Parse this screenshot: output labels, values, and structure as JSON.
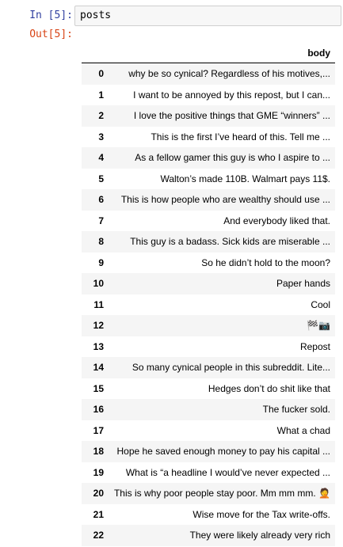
{
  "input_cell": {
    "prompt": "In [5]:",
    "code": "posts"
  },
  "output_cell": {
    "prompt": "Out[5]:"
  },
  "dataframe": {
    "columns": [
      "",
      "body"
    ],
    "rows": [
      {
        "index": "0",
        "body": "why be so cynical? Regardless of his motives,..."
      },
      {
        "index": "1",
        "body": "I want to be annoyed by this repost, but I can..."
      },
      {
        "index": "2",
        "body": "I love the positive things that GME “winners” ..."
      },
      {
        "index": "3",
        "body": "This is the first I’ve heard of this. Tell me ..."
      },
      {
        "index": "4",
        "body": "As a fellow gamer this guy is who I aspire to ..."
      },
      {
        "index": "5",
        "body": "Walton’s made 110B. Walmart pays 11$."
      },
      {
        "index": "6",
        "body": "This is how people who are wealthy should use ..."
      },
      {
        "index": "7",
        "body": "And everybody liked that."
      },
      {
        "index": "8",
        "body": "This guy is a badass. Sick kids are miserable ..."
      },
      {
        "index": "9",
        "body": "So he didn’t hold to the moon?"
      },
      {
        "index": "10",
        "body": "Paper hands"
      },
      {
        "index": "11",
        "body": "Cool"
      },
      {
        "index": "12",
        "body": "🏁📷"
      },
      {
        "index": "13",
        "body": "Repost"
      },
      {
        "index": "14",
        "body": "So many cynical people in this subreddit. Lite..."
      },
      {
        "index": "15",
        "body": "Hedges don’t do shit like that"
      },
      {
        "index": "16",
        "body": "The fucker sold."
      },
      {
        "index": "17",
        "body": "What a chad"
      },
      {
        "index": "18",
        "body": "Hope he saved enough money to pay his capital ..."
      },
      {
        "index": "19",
        "body": "What is “a headline I would’ve never expected ..."
      },
      {
        "index": "20",
        "body": "This is why poor people stay poor. Mm mm mm. 🤦"
      },
      {
        "index": "21",
        "body": "Wise move for the Tax write-offs."
      },
      {
        "index": "22",
        "body": "They were likely already very rich"
      }
    ]
  }
}
